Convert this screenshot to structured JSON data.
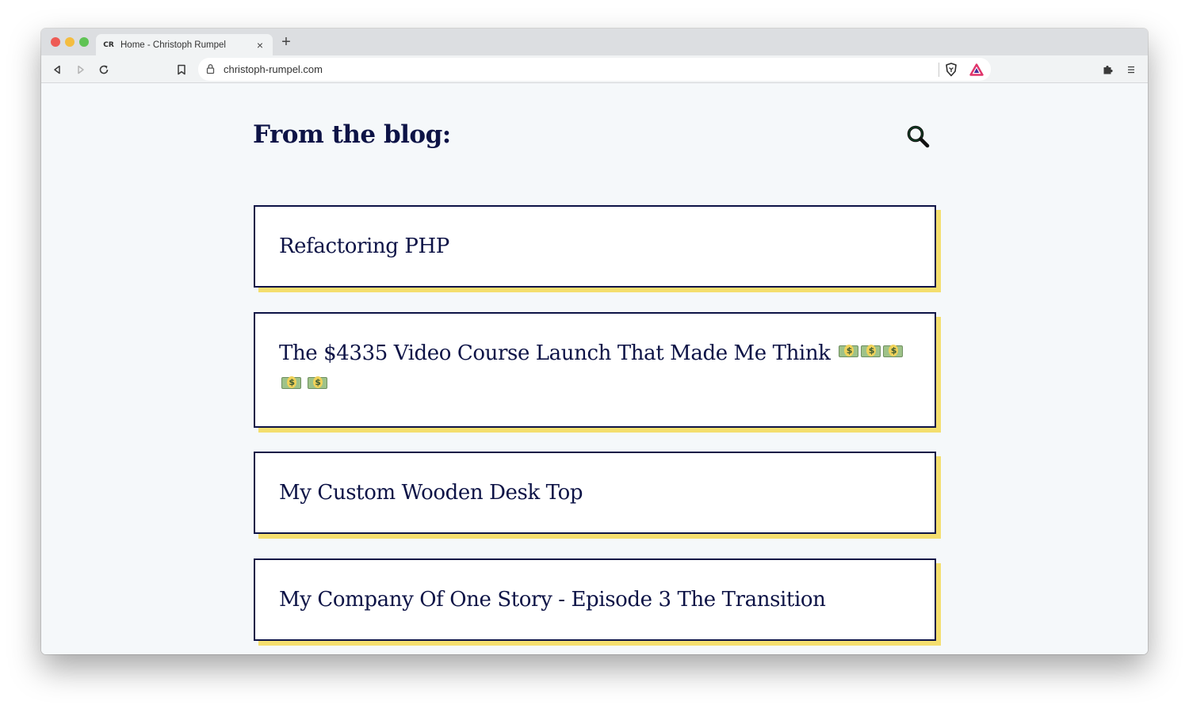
{
  "browser": {
    "tab_title": "Home - Christoph Rumpel",
    "tab_favicon": "CR",
    "tab_close": "×",
    "new_tab": "+",
    "url": "christoph-rumpel.com",
    "icons": [
      "back-icon",
      "forward-icon",
      "reload-icon",
      "bookmark-icon",
      "lock-icon",
      "brave-shields-icon",
      "brave-rewards-icon",
      "extensions-icon",
      "menu-icon"
    ]
  },
  "page": {
    "heading": "From the blog:",
    "search_icon": "search-icon",
    "accent_color": "#f4de6e",
    "text_color": "#0d1346",
    "posts": [
      {
        "title": "Refactoring PHP"
      },
      {
        "title": "The $4335 Video Course Launch That Made Me Think",
        "emoji": "money-with-wings-icon",
        "emoji_count": 5
      },
      {
        "title": "My Custom Wooden Desk Top"
      },
      {
        "title": "My Company Of One Story - Episode 3 The Transition"
      }
    ]
  }
}
